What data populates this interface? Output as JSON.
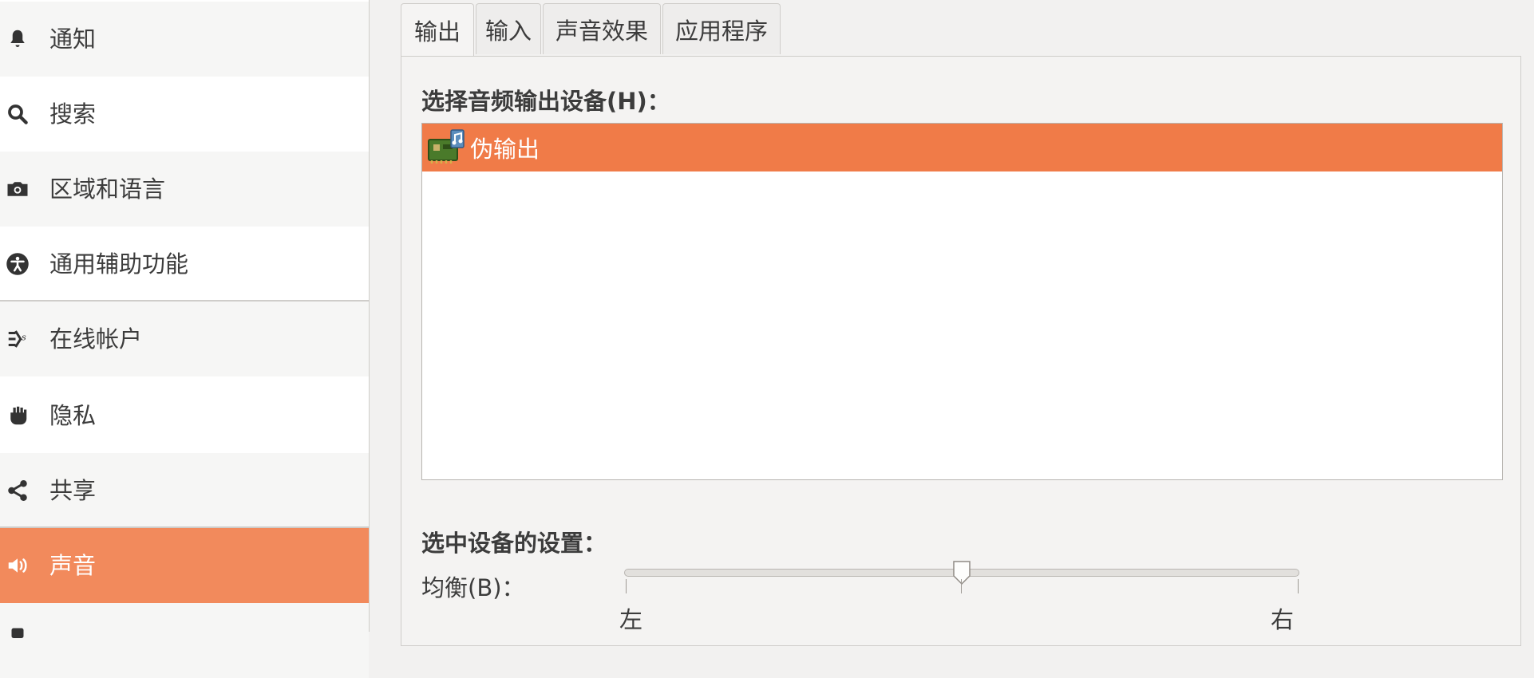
{
  "sidebar": {
    "items": [
      {
        "label": "通知",
        "icon": "bell-icon"
      },
      {
        "label": "搜索",
        "icon": "search-icon"
      },
      {
        "label": "区域和语言",
        "icon": "camera-icon"
      },
      {
        "label": "通用辅助功能",
        "icon": "accessibility-icon"
      },
      {
        "label": "在线帐户",
        "icon": "online-accounts-icon"
      },
      {
        "label": "隐私",
        "icon": "hand-icon"
      },
      {
        "label": "共享",
        "icon": "share-icon"
      },
      {
        "label": "声音",
        "icon": "speaker-icon",
        "selected": true
      }
    ]
  },
  "tabs": [
    {
      "label": "输出",
      "active": true
    },
    {
      "label": "输入"
    },
    {
      "label": "声音效果"
    },
    {
      "label": "应用程序"
    }
  ],
  "output": {
    "select_device_heading": "选择音频输出设备(H)：",
    "devices": [
      {
        "label": "伪输出",
        "icon": "sound-card-icon",
        "selected": true
      }
    ],
    "selected_settings_heading": "选中设备的设置：",
    "balance": {
      "label": "均衡(B)：",
      "left_label": "左",
      "right_label": "右",
      "value": 0.5
    }
  },
  "colors": {
    "accent": "#f07b48",
    "sidebar_selected": "#f28a5c"
  }
}
